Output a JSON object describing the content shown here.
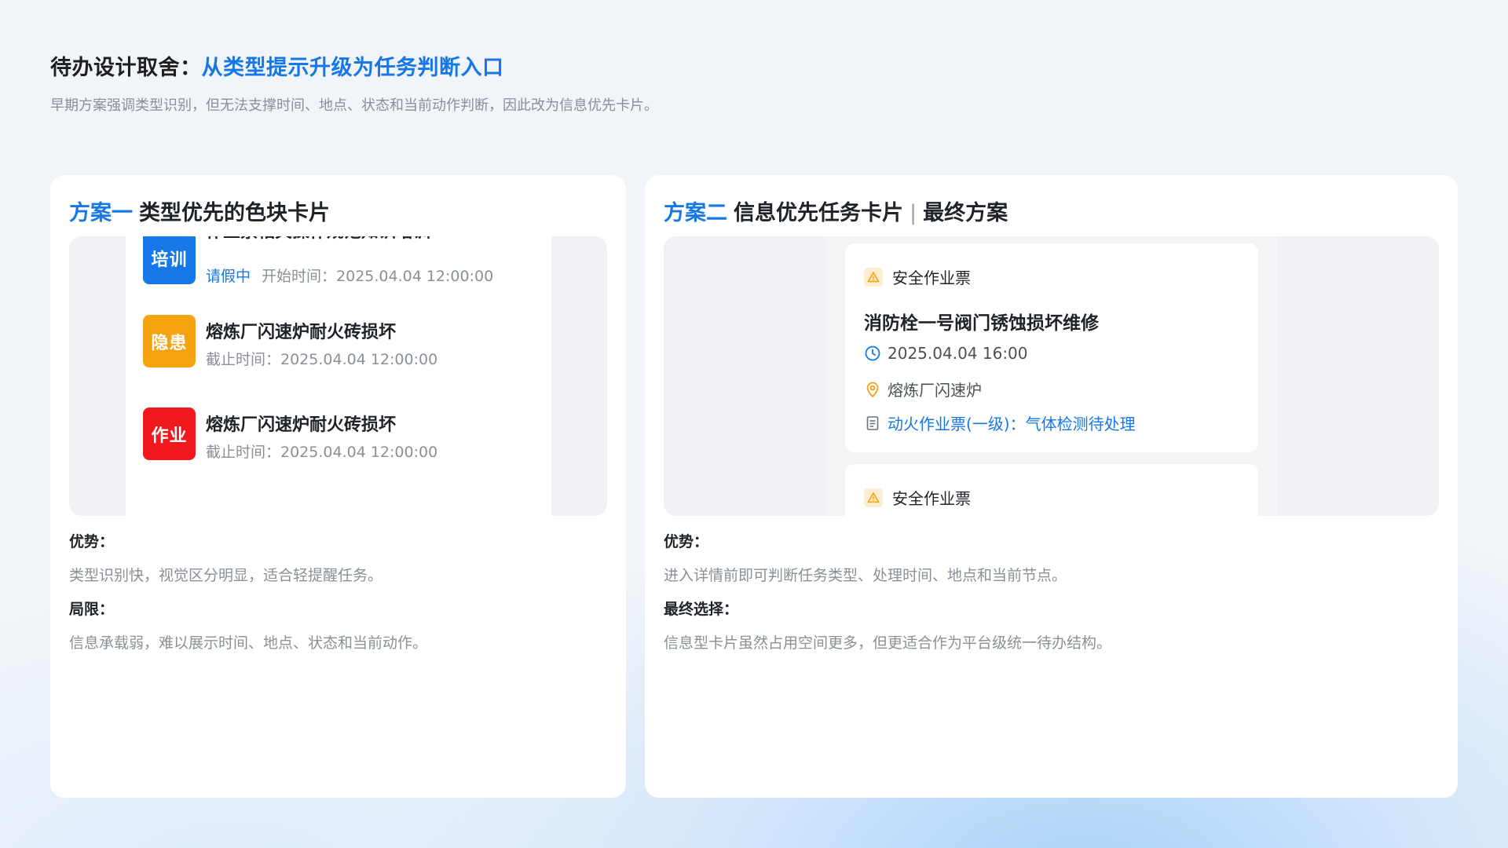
{
  "header": {
    "title_prefix": "待办设计取舍：",
    "title_highlight": "从类型提示升级为任务判断入口",
    "subtitle": "早期方案强调类型识别，但无法支撑时间、地点、状态和当前动作判断，因此改为信息优先卡片。"
  },
  "colors": {
    "accent": "#1677e6",
    "training": "#1677e6",
    "hazard": "#f5a20f",
    "work": "#f0191d",
    "warning_bg": "#fdeccf",
    "warning_icon": "#f5a20f"
  },
  "left_panel": {
    "tag": "方案一",
    "title": "类型优先的色块卡片",
    "items": [
      {
        "badge": "培训",
        "icon_color": "#1677e6",
        "title": "作业票相关操作规范知识培训",
        "status": "请假中",
        "meta": "开始时间：2025.04.04 12:00:00"
      },
      {
        "badge": "隐患",
        "icon_color": "#f5a20f",
        "title": "熔炼厂闪速炉耐火砖损坏",
        "status": "",
        "meta": "截止时间：2025.04.04 12:00:00"
      },
      {
        "badge": "作业",
        "icon_color": "#f0191d",
        "title": "熔炼厂闪速炉耐火砖损坏",
        "status": "",
        "meta": "截止时间：2025.04.04 12:00:00"
      }
    ],
    "pros_label": "优势：",
    "pros_text": "类型识别快，视觉区分明显，适合轻提醒任务。",
    "cons_label": "局限：",
    "cons_text": "信息承载弱，难以展示时间、地点、状态和当前动作。"
  },
  "right_panel": {
    "tag": "方案二",
    "title": "信息优先任务卡片",
    "separator": "|",
    "title_suffix": "最终方案",
    "cards": [
      {
        "category": "安全作业票",
        "title": "消防栓一号阀门锈蚀损坏维修",
        "time": "2025.04.04 16:00",
        "location": "熔炼厂闪速炉",
        "ticket_link": "动火作业票(一级)：",
        "ticket_status": "气体检测待处理",
        "icons": [
          "warning-icon",
          "clock-icon",
          "location-pin-icon",
          "document-icon"
        ]
      },
      {
        "category": "安全作业票"
      }
    ],
    "pros_label": "优势：",
    "pros_text": "进入详情前即可判断任务类型、处理时间、地点和当前节点。",
    "final_label": "最终选择：",
    "final_text": "信息型卡片虽然占用空间更多，但更适合作为平台级统一待办结构。"
  }
}
